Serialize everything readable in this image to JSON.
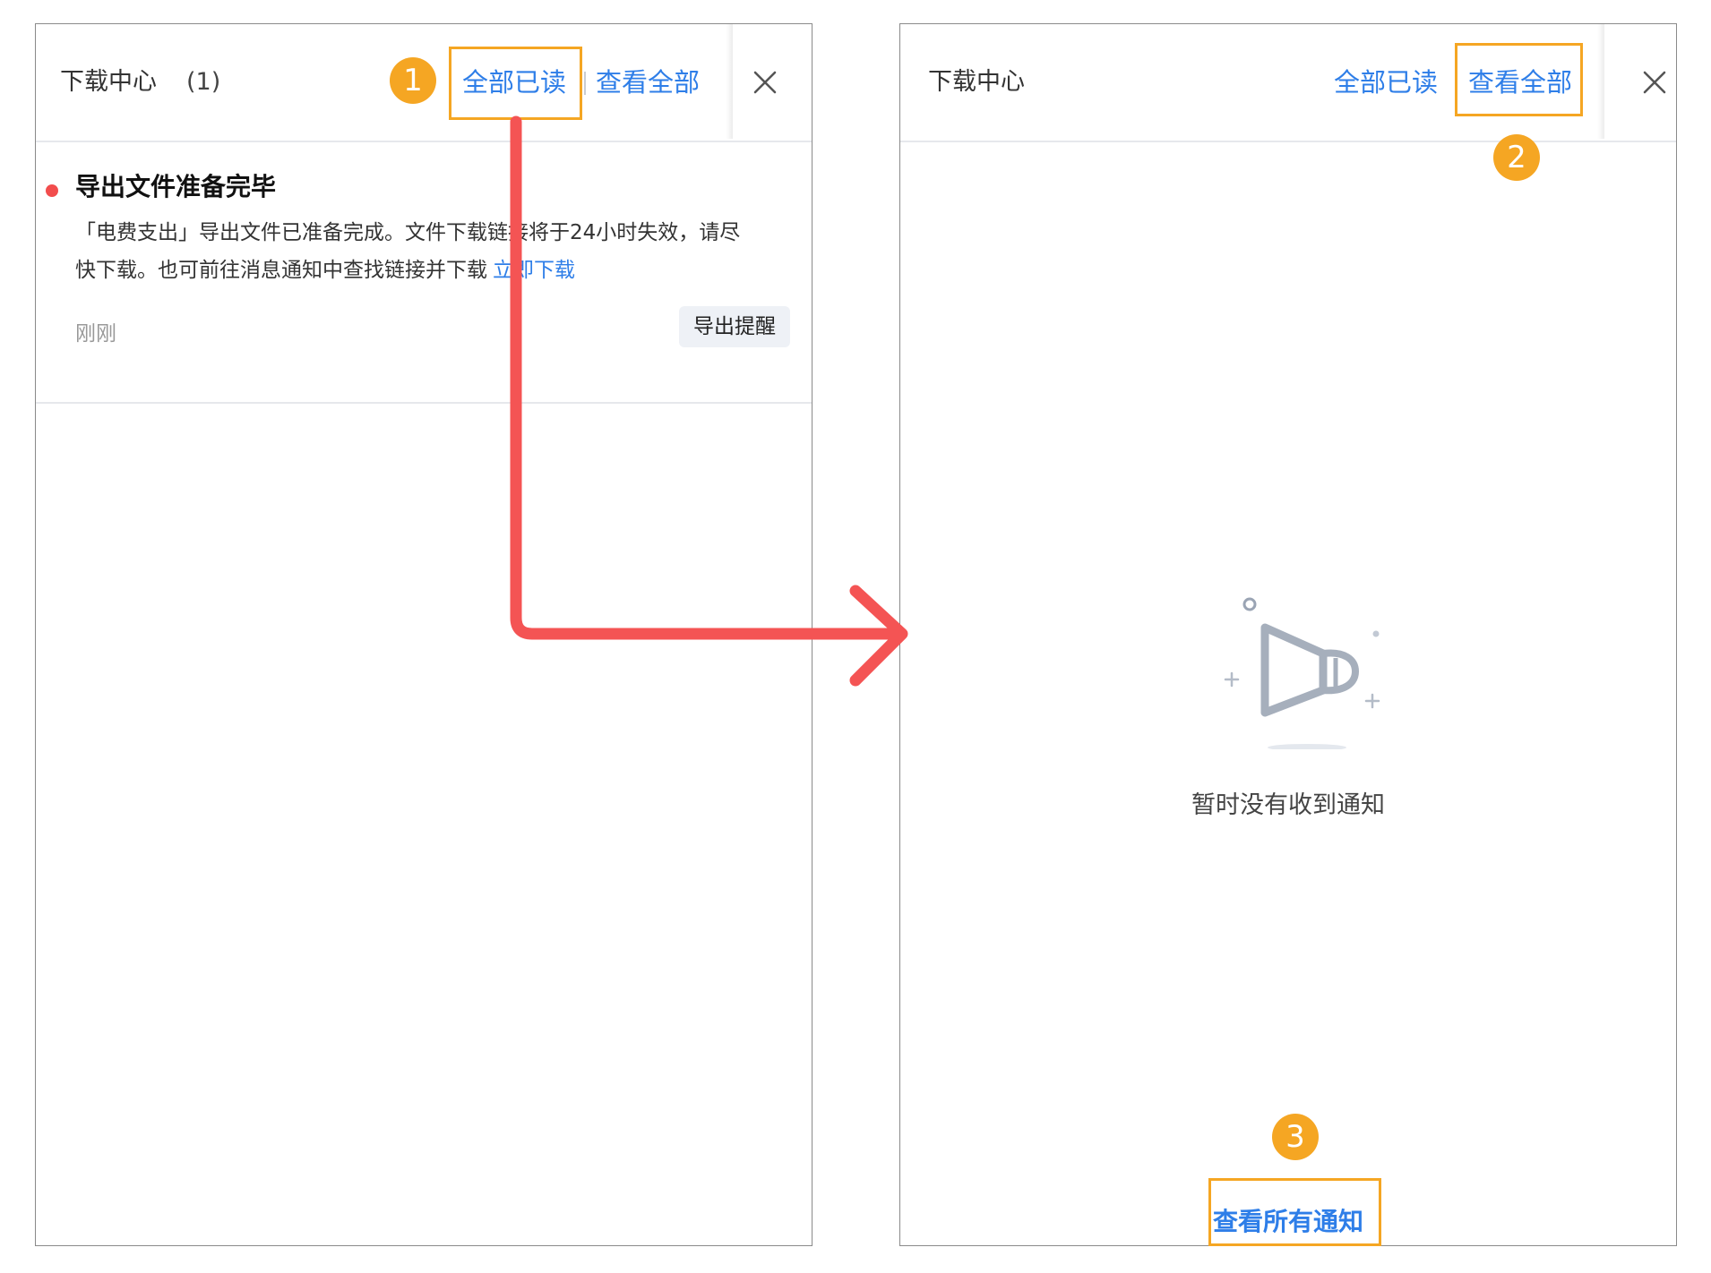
{
  "left_panel": {
    "title": "下载中心",
    "count": "(1)",
    "mark_all_read": "全部已读",
    "view_all": "查看全部",
    "close_icon": "close-icon",
    "notification": {
      "title": "导出文件准备完毕",
      "body_line1": "「电费支出」导出文件已准备完成。文件下载链接将于24小时失效，请尽",
      "body_line2": "快下载。也可前往消息通知中查找链接并下载",
      "action_link": "立即下载",
      "time": "刚刚",
      "tag": "导出提醒"
    }
  },
  "right_panel": {
    "title": "下载中心",
    "mark_all_read": "全部已读",
    "view_all": "查看全部",
    "close_icon": "close-icon",
    "empty_icon": "megaphone-icon",
    "empty_text": "暂时没有收到通知",
    "footer_link": "查看所有通知"
  },
  "annotations": {
    "step1": "1",
    "step2": "2",
    "step3": "3",
    "highlight_color": "#f5a623",
    "arrow_color": "#f45454"
  },
  "colors": {
    "link": "#2e7ee8",
    "unread_dot": "#f24d4d",
    "divider": "#e6e8ec"
  }
}
